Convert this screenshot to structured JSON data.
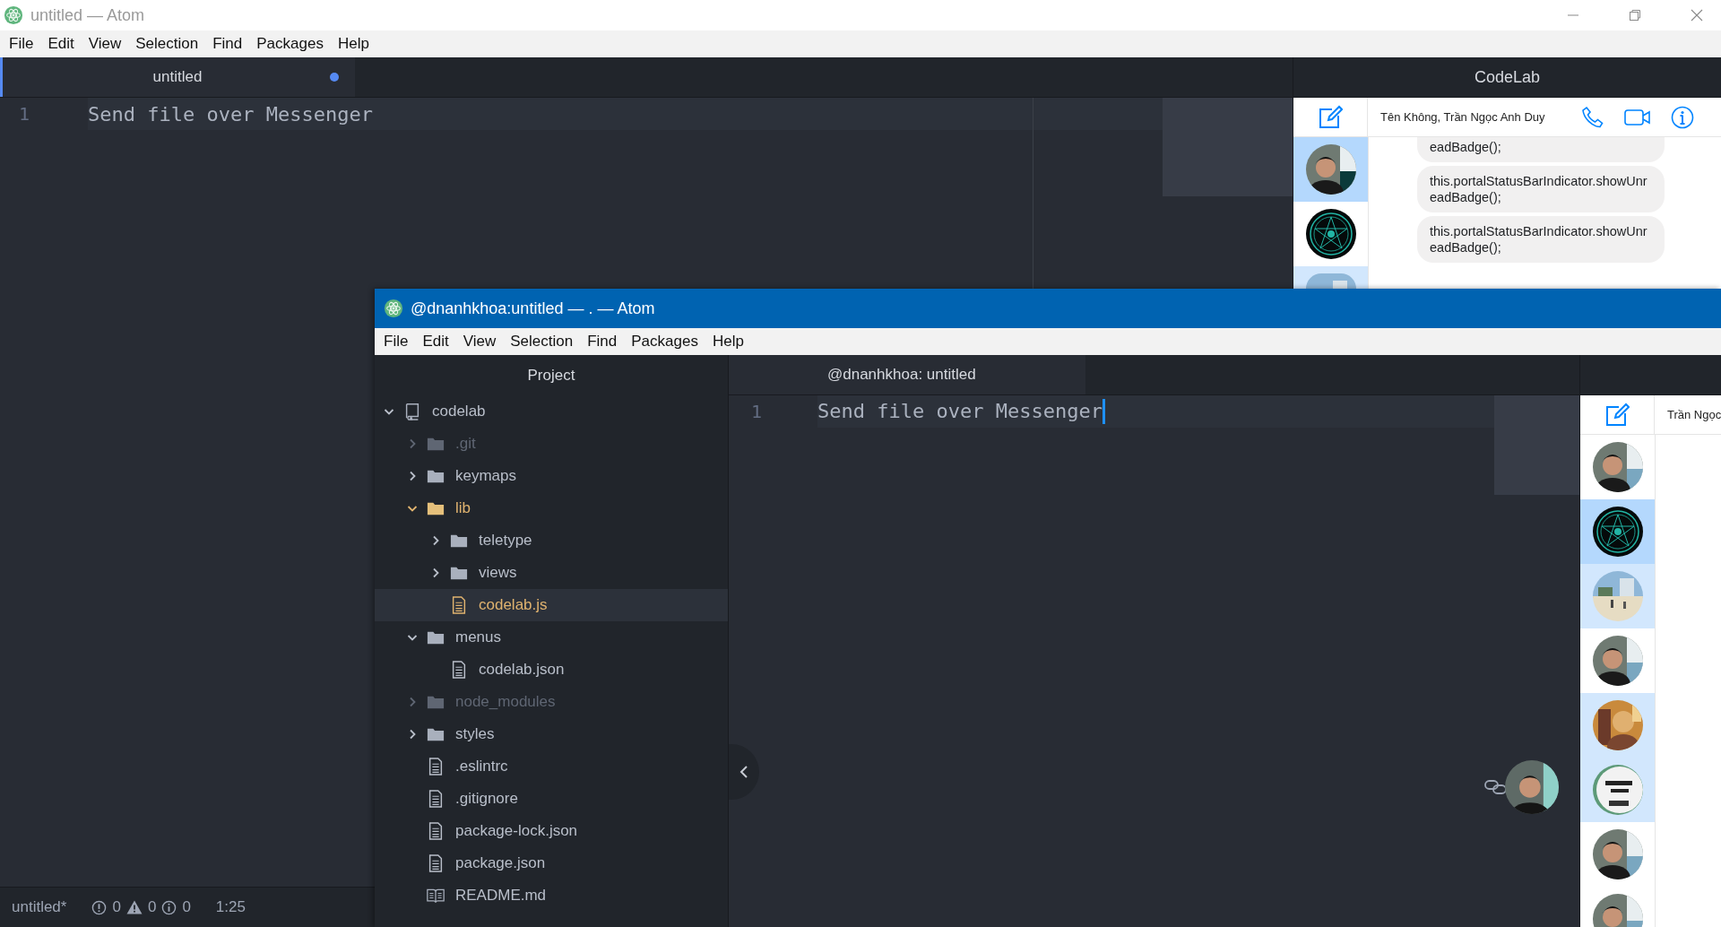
{
  "back_window": {
    "title": "untitled — Atom",
    "menu": [
      "File",
      "Edit",
      "View",
      "Selection",
      "Find",
      "Packages",
      "Help"
    ],
    "tabs": [
      {
        "label": "untitled",
        "selected": true,
        "modified": true
      }
    ],
    "editor": {
      "lines": [
        {
          "number": "1",
          "text": "Send file over Messenger"
        }
      ]
    },
    "side_panel": {
      "title": "CodeLab",
      "conversation": "Tên Không, Trần Ngọc Anh Duy",
      "avatars": [
        {
          "selected": true,
          "unread": false
        },
        {
          "selected": false,
          "unread": false
        },
        {
          "selected": false,
          "unread": true
        }
      ],
      "messages": [
        "eadBadge();",
        "this.portalStatusBarIndicator.showUnreadBadge();",
        "this.portalStatusBarIndicator.showUnreadBadge();"
      ]
    },
    "status_bar": {
      "file": "untitled*",
      "errors": "0",
      "warnings": "0",
      "infos": "0",
      "cursor": "1:25"
    }
  },
  "front_window": {
    "title": "@dnanhkhoa:untitled — . — Atom",
    "menu": [
      "File",
      "Edit",
      "View",
      "Selection",
      "Find",
      "Packages",
      "Help"
    ],
    "tree_title": "Project",
    "tree": [
      {
        "name": "codelab",
        "kind": "repo",
        "expanded": true,
        "selected": false,
        "modified": false,
        "ignored": false,
        "children": [
          {
            "name": ".git",
            "kind": "folder",
            "expanded": false,
            "selected": false,
            "modified": false,
            "ignored": true
          },
          {
            "name": "keymaps",
            "kind": "folder",
            "expanded": false,
            "selected": false,
            "modified": false,
            "ignored": false
          },
          {
            "name": "lib",
            "kind": "folder",
            "expanded": true,
            "selected": false,
            "modified": true,
            "ignored": false,
            "children": [
              {
                "name": "teletype",
                "kind": "folder",
                "expanded": false,
                "selected": false,
                "modified": false,
                "ignored": false
              },
              {
                "name": "views",
                "kind": "folder",
                "expanded": false,
                "selected": false,
                "modified": false,
                "ignored": false
              },
              {
                "name": "codelab.js",
                "kind": "file",
                "selected": true,
                "modified": true,
                "ignored": false
              }
            ]
          },
          {
            "name": "menus",
            "kind": "folder",
            "expanded": true,
            "selected": false,
            "modified": false,
            "ignored": false,
            "children": [
              {
                "name": "codelab.json",
                "kind": "file",
                "selected": false,
                "modified": false,
                "ignored": false
              }
            ]
          },
          {
            "name": "node_modules",
            "kind": "folder",
            "expanded": false,
            "selected": false,
            "modified": false,
            "ignored": true
          },
          {
            "name": "styles",
            "kind": "folder",
            "expanded": false,
            "selected": false,
            "modified": false,
            "ignored": false
          },
          {
            "name": ".eslintrc",
            "kind": "file",
            "selected": false,
            "modified": false,
            "ignored": false
          },
          {
            "name": ".gitignore",
            "kind": "file",
            "selected": false,
            "modified": false,
            "ignored": false
          },
          {
            "name": "package-lock.json",
            "kind": "file",
            "selected": false,
            "modified": false,
            "ignored": false
          },
          {
            "name": "package.json",
            "kind": "file",
            "selected": false,
            "modified": false,
            "ignored": false
          },
          {
            "name": "README.md",
            "kind": "readme",
            "selected": false,
            "modified": false,
            "ignored": false
          }
        ]
      }
    ],
    "tabs": [
      {
        "label": "@dnanhkhoa: untitled",
        "selected": true
      }
    ],
    "editor": {
      "lines": [
        {
          "number": "1",
          "text": "Send file over Messenger",
          "cursor_at_end": true
        }
      ]
    },
    "side_panel": {
      "conversation": "Trần Ngọc",
      "avatars": [
        {
          "selected": false,
          "unread": false
        },
        {
          "selected": true,
          "unread": false
        },
        {
          "selected": false,
          "unread": true
        },
        {
          "selected": false,
          "unread": false
        },
        {
          "selected": false,
          "unread": true
        },
        {
          "selected": false,
          "unread": true
        },
        {
          "selected": false,
          "unread": false
        },
        {
          "selected": false,
          "unread": false
        }
      ]
    }
  }
}
